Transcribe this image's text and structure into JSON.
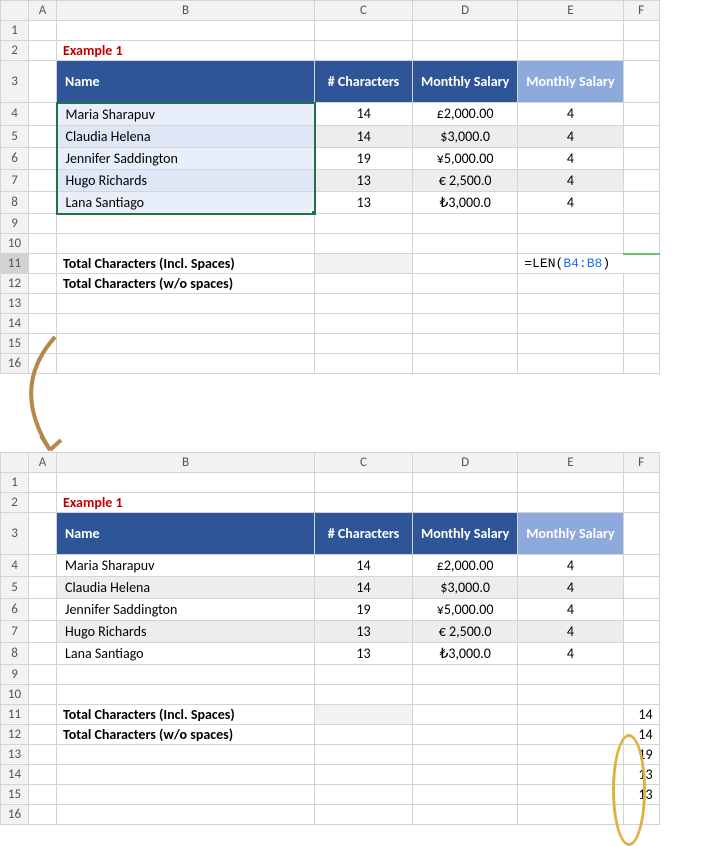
{
  "columns": [
    "",
    "A",
    "B",
    "C",
    "D",
    "E",
    "F"
  ],
  "rows": [
    "1",
    "2",
    "3",
    "4",
    "5",
    "6",
    "7",
    "8",
    "9",
    "10",
    "11",
    "12",
    "13",
    "14",
    "15",
    "16"
  ],
  "example_label": "Example 1",
  "headers": {
    "name": "Name",
    "chars": "# Characters",
    "monthly_salary": "Monthly Salary",
    "monthly_salary2": "Monthly Salary"
  },
  "data_rows": [
    {
      "name": "Maria Sharapuv",
      "chars": "14",
      "salary": "£2,000.00",
      "len4": "4"
    },
    {
      "name": "Claudia Helena",
      "chars": "14",
      "salary": "$3,000.0",
      "len4": "4"
    },
    {
      "name": "Jennifer Saddington",
      "chars": "19",
      "salary": "¥5,000.00",
      "len4": "4"
    },
    {
      "name": "Hugo Richards",
      "chars": "13",
      "salary": "€ 2,500.0",
      "len4": "4"
    },
    {
      "name": "Lana Santiago",
      "chars": "13",
      "salary": "₺3,000.0",
      "len4": "4"
    }
  ],
  "totals": {
    "incl": "Total Characters (Incl. Spaces)",
    "wo": "Total Characters (w/o spaces)"
  },
  "formula_prefix": "=LEN(",
  "formula_ref": "B4:B8",
  "formula_suffix": ")",
  "results": [
    "14",
    "14",
    "19",
    "13",
    "13"
  ]
}
